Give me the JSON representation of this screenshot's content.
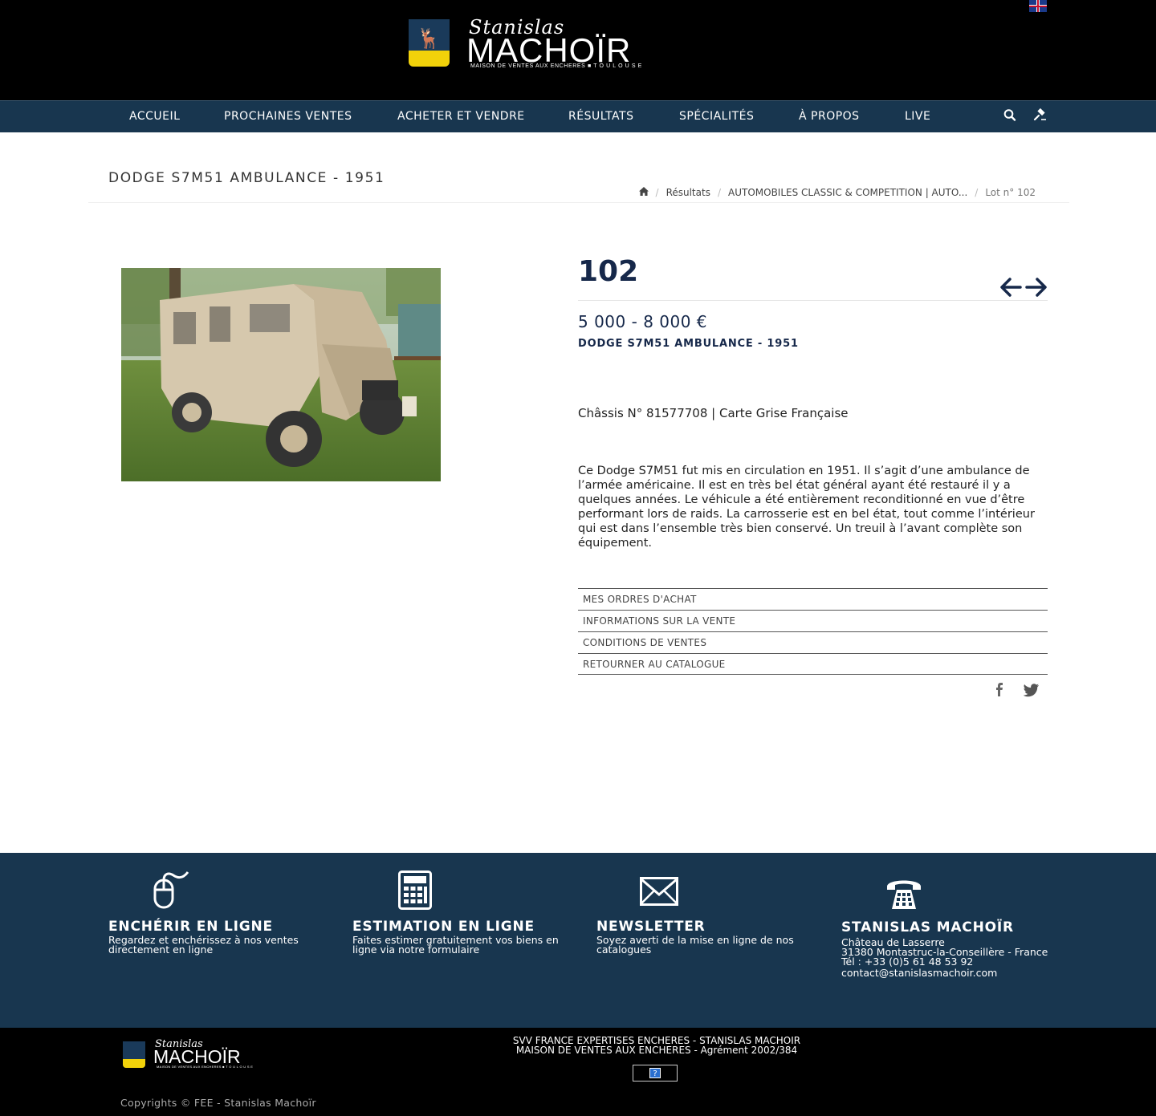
{
  "header": {
    "language_flag": "en-flag",
    "logo": {
      "script": "Stanislas",
      "name": "MACHOÏR",
      "tagline": "MAISON DE VENTES AUX ENCHERES ■ T O U L O U S E"
    }
  },
  "nav": {
    "items": [
      "ACCUEIL",
      "PROCHAINES VENTES",
      "ACHETER ET VENDRE",
      "RÉSULTATS",
      "SPÉCIALITÉS",
      "À PROPOS",
      "LIVE"
    ],
    "icons": [
      "search-icon",
      "gavel-icon"
    ]
  },
  "page": {
    "title": "DODGE S7M51 AMBULANCE - 1951",
    "breadcrumb": [
      "Résultats",
      "AUTOMOBILES CLASSIC & COMPETITION | AUTO...",
      "Lot n° 102"
    ]
  },
  "lot": {
    "number": "102",
    "estimate": "5 000 - 8 000 €",
    "title": "DODGE S7M51 AMBULANCE - 1951",
    "chassis": "Châssis N° 81577708 | Carte Grise Française",
    "description": "Ce Dodge S7M51 fut mis en circulation en 1951. Il s’agit d’une ambulance de l’armée américaine. Il est en très bel état général ayant été restauré il y a quelques années. Le véhicule a été entièrement reconditionné en vue d’être performant lors de raids. La carrosserie est en bel état, tout comme l’intérieur qui est dans l’ensemble très bien conservé. Un treuil à l’avant complète son équipement.",
    "links": [
      "MES ORDRES D'ACHAT",
      "INFORMATIONS SUR LA VENTE",
      "CONDITIONS DE VENTES",
      "RETOURNER AU CATALOGUE"
    ]
  },
  "footer": {
    "columns": [
      {
        "icon": "mouse-icon",
        "title": "ENCHÉRIR EN LIGNE",
        "text": "Regardez et enchérissez à nos ventes directement en ligne"
      },
      {
        "icon": "calculator-icon",
        "title": "ESTIMATION EN LIGNE",
        "text": "Faites estimer gratuitement vos biens en ligne via notre formulaire"
      },
      {
        "icon": "envelope-icon",
        "title": "NEWSLETTER",
        "text": "Soyez averti de la mise en ligne de nos catalogues"
      },
      {
        "icon": "phone-icon",
        "title": "STANISLAS MACHOÏR",
        "lines": [
          "Château de Lasserre",
          "31380 Montastruc-la-Conseillère - France",
          "Tél : +33 (0)5 61 48 53 92",
          "contact@stanislasmachoir.com"
        ]
      }
    ],
    "bottom": {
      "line1": "SVV FRANCE EXPERTISES ENCHERES - STANISLAS MACHOIR",
      "line2": "MAISON DE VENTES AUX ENCHERES - Agrément 2002/384",
      "help": "?",
      "copyright": "Copyrights © FEE - Stanislas Machoïr"
    }
  },
  "colors": {
    "nav_bg": "#18364f",
    "accent": "#16284a",
    "logo_yellow": "#f2d20a"
  }
}
